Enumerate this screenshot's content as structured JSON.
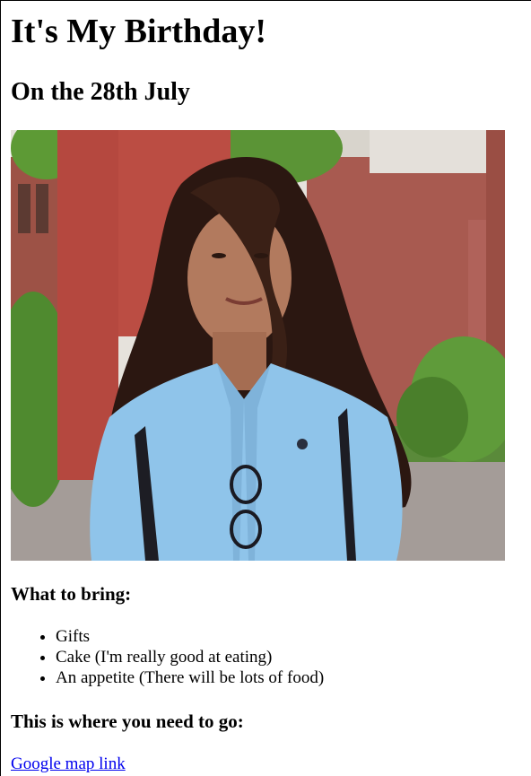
{
  "header": {
    "title": "It's My Birthday!",
    "subtitle": "On the 28th July"
  },
  "photo": {
    "icon": "portrait-photo"
  },
  "bring": {
    "heading": "What to bring:",
    "items": [
      {
        "label": "Gifts"
      },
      {
        "label": "Cake (I'm really good at eating)"
      },
      {
        "label": "An appetite (There will be lots of food)"
      }
    ]
  },
  "where": {
    "heading": "This is where you need to go:",
    "link_label": "Google map link"
  },
  "colors": {
    "link": "#0000ee",
    "shirt": "#8fc4ea",
    "brick": "#a9574d",
    "pillar": "#b5483f",
    "foliage": "#4f8a2f",
    "hair": "#2b1711",
    "skin": "#b27a5e"
  }
}
